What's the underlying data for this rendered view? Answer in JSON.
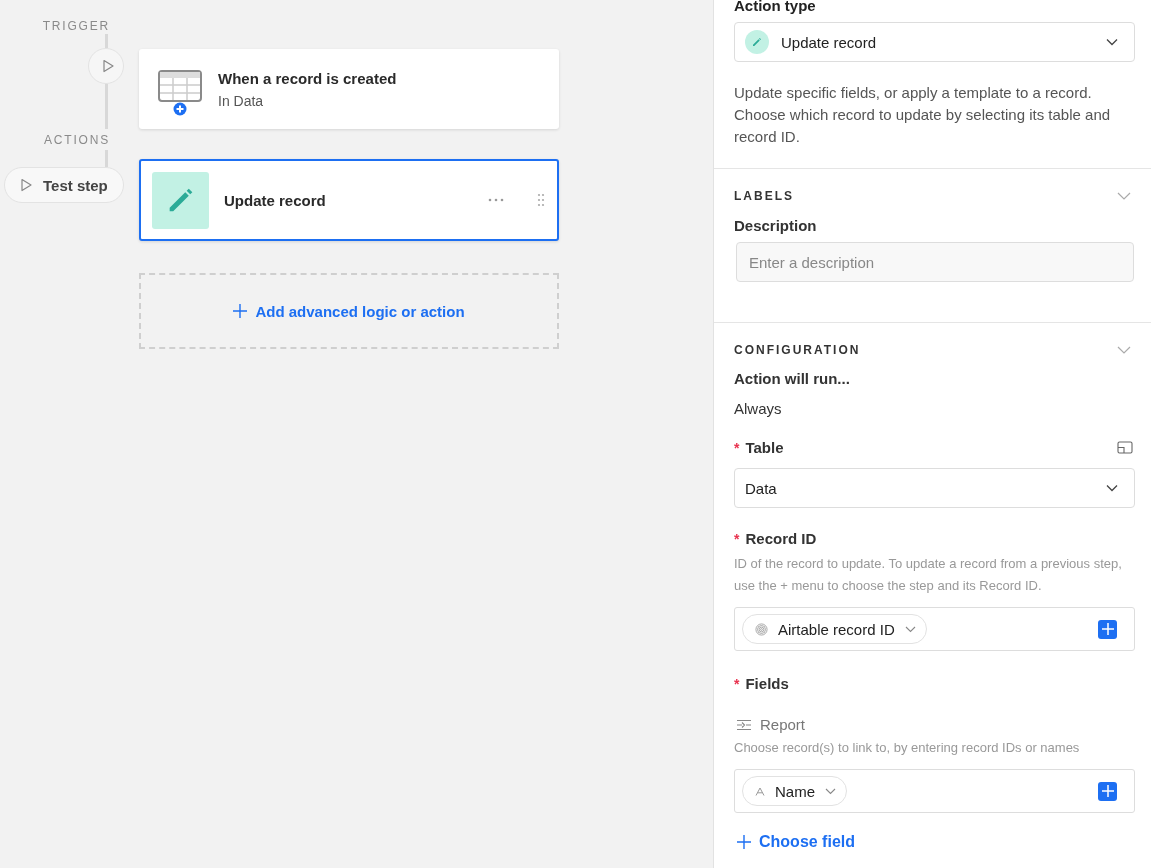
{
  "canvas": {
    "trigger": {
      "section_label": "TRIGGER",
      "title": "When a record is created",
      "subtitle": "In Data"
    },
    "actions_label": "ACTIONS",
    "test_step_button": "Test step",
    "action": {
      "title": "Update record",
      "selected": true
    },
    "add_button": "Add advanced logic or action"
  },
  "panel": {
    "action_type": {
      "label": "Action type",
      "value": "Update record",
      "description": "Update specific fields, or apply a template to a record. Choose which record to update by selecting its table and record ID."
    },
    "labels_section": {
      "heading": "LABELS",
      "description_label": "Description",
      "description_placeholder": "Enter a description"
    },
    "configuration": {
      "heading": "CONFIGURATION",
      "run_label": "Action will run...",
      "run_value": "Always",
      "table": {
        "marker": "*",
        "label": "Table",
        "value": "Data"
      },
      "record_id": {
        "marker": "*",
        "label": "Record ID",
        "help": "ID of the record to update. To update a record from a previous step, use the + menu to choose the step and its Record ID.",
        "token": "Airtable record ID"
      },
      "fields": {
        "marker": "*",
        "label": "Fields",
        "field_name": "Report",
        "help": "Choose record(s) to link to, by entering record IDs or names",
        "token": "Name"
      },
      "choose_field": "Choose field"
    }
  }
}
